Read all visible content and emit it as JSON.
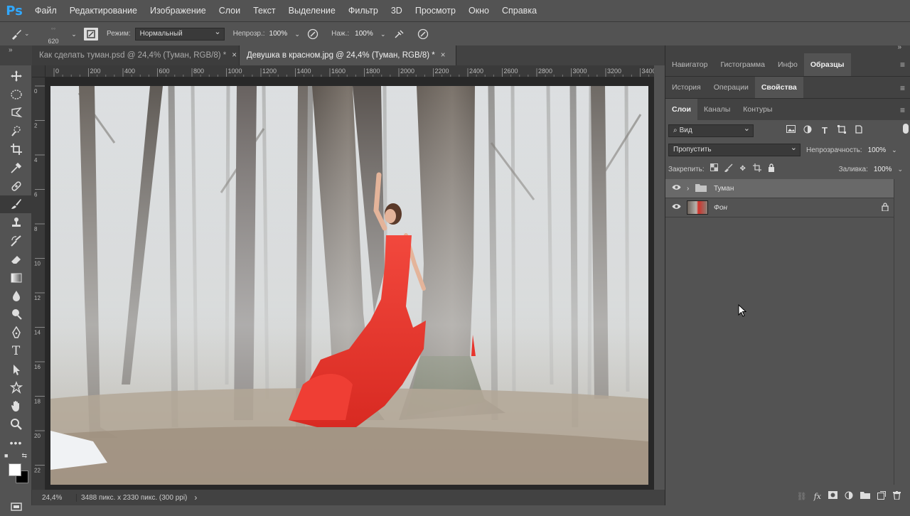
{
  "app": {
    "logo": "Ps"
  },
  "menu": [
    "Файл",
    "Редактирование",
    "Изображение",
    "Слои",
    "Текст",
    "Выделение",
    "Фильтр",
    "3D",
    "Просмотр",
    "Окно",
    "Справка"
  ],
  "options": {
    "brush_size": "620",
    "mode_label": "Режим:",
    "mode_value": "Нормальный",
    "opacity_label": "Непрозр.:",
    "opacity_value": "100%",
    "flow_label": "Наж.:",
    "flow_value": "100%"
  },
  "tabs": [
    {
      "label": "Как сделать туман.psd @ 24,4% (Туман, RGB/8) *",
      "close": "×"
    },
    {
      "label": "Девушка в красном.jpg @ 24,4% (Туман, RGB/8) *",
      "close": "×"
    }
  ],
  "ruler_h": [
    "0",
    "200",
    "400",
    "600",
    "800",
    "1000",
    "1200",
    "1400",
    "1600",
    "1800",
    "2000",
    "2200",
    "2400",
    "2600",
    "2800",
    "3000",
    "3200",
    "3400"
  ],
  "ruler_v": [
    "0",
    "2",
    "4",
    "6",
    "8",
    "10",
    "12",
    "14",
    "16",
    "18",
    "20",
    "22"
  ],
  "status": {
    "zoom": "24,4%",
    "info": "3488 пикс. x 2330 пикс. (300 ppi)",
    "arrow": "›"
  },
  "panels": {
    "row1": [
      "Навигатор",
      "Гистограмма",
      "Инфо",
      "Образцы"
    ],
    "row2": [
      "История",
      "Операции",
      "Свойства"
    ],
    "row3": [
      "Слои",
      "Каналы",
      "Контуры"
    ]
  },
  "layers_panel": {
    "filter_value": "Вид",
    "blend_value": "Пропустить",
    "opacity_label": "Непрозрачность:",
    "opacity_value": "100%",
    "lock_label": "Закрепить:",
    "fill_label": "Заливка:",
    "fill_value": "100%",
    "layers": [
      {
        "name": "Туман",
        "type": "group"
      },
      {
        "name": "Фон",
        "type": "image"
      }
    ]
  },
  "colors": {
    "accent": "#31a8ff",
    "dress": "#e8342c",
    "panel": "#535353",
    "dark": "#424242"
  }
}
